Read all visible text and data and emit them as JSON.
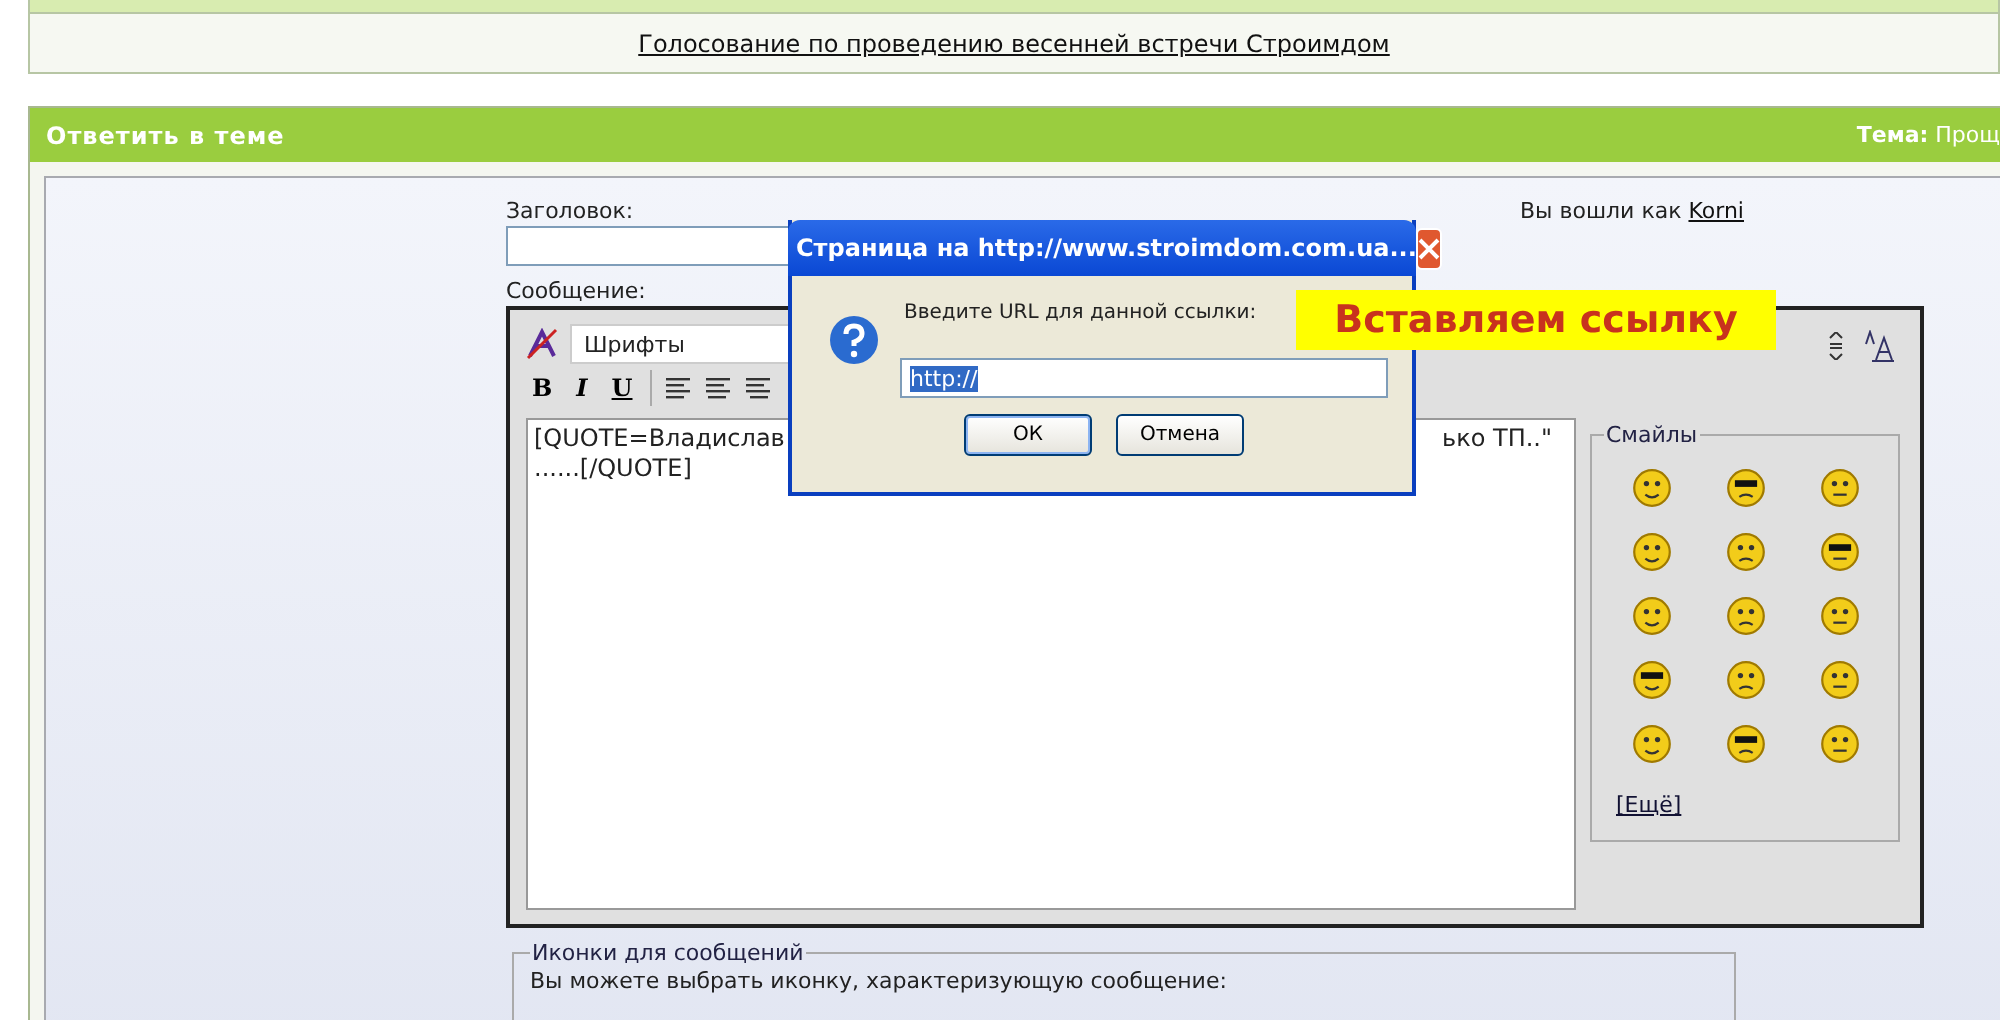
{
  "top_link": "Голосование по проведению весенней встречи Строимдом",
  "reply_panel": {
    "title": "Ответить в теме",
    "topic_label": "Тема:",
    "topic_value": "Прощ"
  },
  "form": {
    "subject_label": "Заголовок:",
    "logged_in_text": "Вы вошли как",
    "user_link": "Korni",
    "message_label": "Сообщение:",
    "font_select": "Шрифты",
    "format_buttons": [
      "B",
      "I",
      "U"
    ],
    "text_lines": [
      {
        "left": "[QUOTE=Владислав",
        "right": "ько ТП..\""
      },
      {
        "left": "......[/QUOTE]"
      }
    ],
    "smilies": {
      "title": "Смайлы",
      "more": "[Ещё]"
    }
  },
  "icons_section": {
    "title": "Иконки для сообщений",
    "hint": "Вы можете выбрать иконку, характеризующую сообщение:"
  },
  "dialog": {
    "title": "Страница на http://www.stroimdom.com.ua...",
    "prompt": "Введите URL для данной ссылки:",
    "value": "http://",
    "buttons": [
      "ОК",
      "Отмена"
    ]
  },
  "annotation": "Вставляем ссылку"
}
